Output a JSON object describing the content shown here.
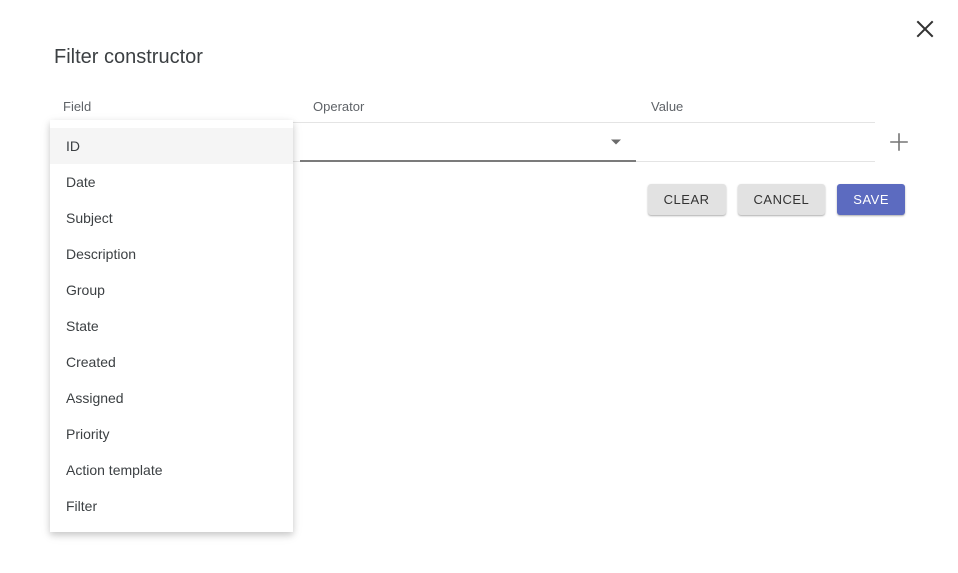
{
  "dialog": {
    "title": "Filter constructor",
    "close_icon": "close-icon"
  },
  "columns": {
    "field_label": "Field",
    "operator_label": "Operator",
    "value_label": "Value"
  },
  "row": {
    "field_value": "",
    "operator_value": "",
    "operator_caret_icon": "chevron-down-icon",
    "value_value": "",
    "value_placeholder": "",
    "add_icon": "plus-icon"
  },
  "actions": {
    "clear_label": "CLEAR",
    "cancel_label": "CANCEL",
    "save_label": "SAVE"
  },
  "field_dropdown": {
    "open": true,
    "selected_index": 0,
    "items": [
      {
        "label": "ID"
      },
      {
        "label": "Date"
      },
      {
        "label": "Subject"
      },
      {
        "label": "Description"
      },
      {
        "label": "Group"
      },
      {
        "label": "State"
      },
      {
        "label": "Created"
      },
      {
        "label": "Assigned"
      },
      {
        "label": "Priority"
      },
      {
        "label": "Action template"
      },
      {
        "label": "Filter"
      }
    ]
  },
  "colors": {
    "primary": "#5c6bc0",
    "button_grey": "#e2e2e2",
    "text": "#3c4043",
    "label_text": "#5f6368",
    "highlight": "#f5f5f5"
  }
}
